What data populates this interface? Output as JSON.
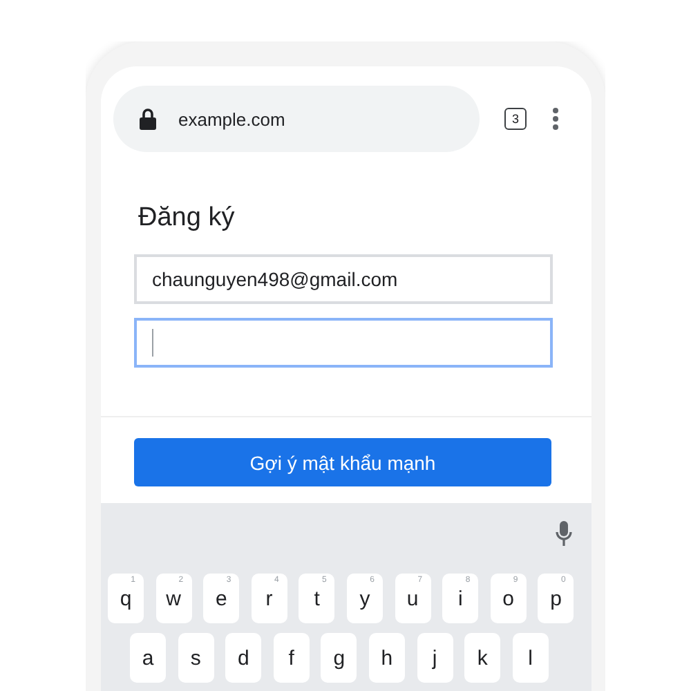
{
  "browser": {
    "url": "example.com",
    "tab_count": "3"
  },
  "form": {
    "title": "Đăng ký",
    "fields": [
      {
        "value": "chaunguyen498@gmail.com",
        "focused": false
      },
      {
        "focused": true
      }
    ],
    "suggest_button": "Gợi ý mật khẩu mạnh"
  },
  "keyboard": {
    "rows": [
      [
        {
          "key": "q",
          "hint": "1"
        },
        {
          "key": "w",
          "hint": "2"
        },
        {
          "key": "e",
          "hint": "3"
        },
        {
          "key": "r",
          "hint": "4"
        },
        {
          "key": "t",
          "hint": "5"
        },
        {
          "key": "y",
          "hint": "6"
        },
        {
          "key": "u",
          "hint": "7"
        },
        {
          "key": "i",
          "hint": "8"
        },
        {
          "key": "o",
          "hint": "9"
        },
        {
          "key": "p",
          "hint": "0"
        }
      ],
      [
        {
          "key": "a"
        },
        {
          "key": "s"
        },
        {
          "key": "d"
        },
        {
          "key": "f"
        },
        {
          "key": "g"
        },
        {
          "key": "h"
        },
        {
          "key": "j"
        },
        {
          "key": "k"
        },
        {
          "key": "l"
        }
      ]
    ]
  }
}
